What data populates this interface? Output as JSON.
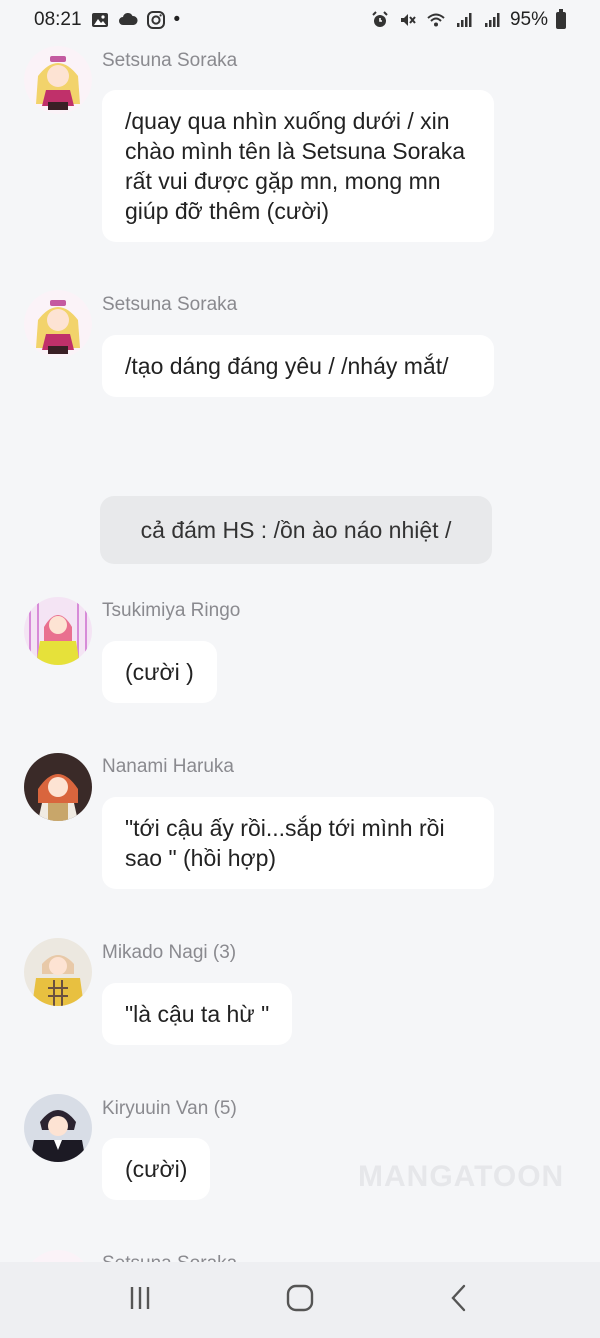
{
  "status_bar": {
    "time": "08:21",
    "dot": "•",
    "battery": "95%",
    "left_icons": [
      "image-icon",
      "cloud-icon",
      "instagram-icon"
    ],
    "right_icons": [
      "alarm-icon",
      "mute-icon",
      "wifi-icon",
      "signal-icon",
      "signal-icon",
      "battery-icon"
    ]
  },
  "messages": [
    {
      "sender": "Setsuna Soraka",
      "text": "/quay qua nhìn xuống dưới / xin chào mình tên là Setsuna Soraka rất vui được gặp mn, mong mn giúp đỡ thêm (cười)",
      "avatar_color": "#f2d36b"
    },
    {
      "sender": "Setsuna Soraka",
      "text": "/tạo dáng đáng yêu / /nháy mắt/",
      "avatar_color": "#f2d36b"
    },
    {
      "sender": "Tsukimiya Ringo",
      "text": "(cười )",
      "avatar_color": "#e6e13a"
    },
    {
      "sender": "Nanami Haruka",
      "text": "\"tới cậu ấy rồi...sắp tới mình rồi sao \" (hồi hợp)",
      "avatar_color": "#d9653d"
    },
    {
      "sender": "Mikado Nagi (3)",
      "text": "\"là cậu ta hừ \"",
      "avatar_color": "#e8c040"
    },
    {
      "sender": "Kiryuuin Van (5)",
      "text": "(cười)",
      "avatar_color": "#2b2330"
    },
    {
      "sender": "Setsuna Soraka",
      "text": "",
      "avatar_color": "#f2d36b"
    }
  ],
  "narration": "cả đám HS : /ồn ào náo nhiệt /",
  "watermark": "MANGATOON",
  "nav_bar": {
    "recents_icon": "recents-icon",
    "home_icon": "home-icon",
    "back_icon": "back-icon"
  }
}
